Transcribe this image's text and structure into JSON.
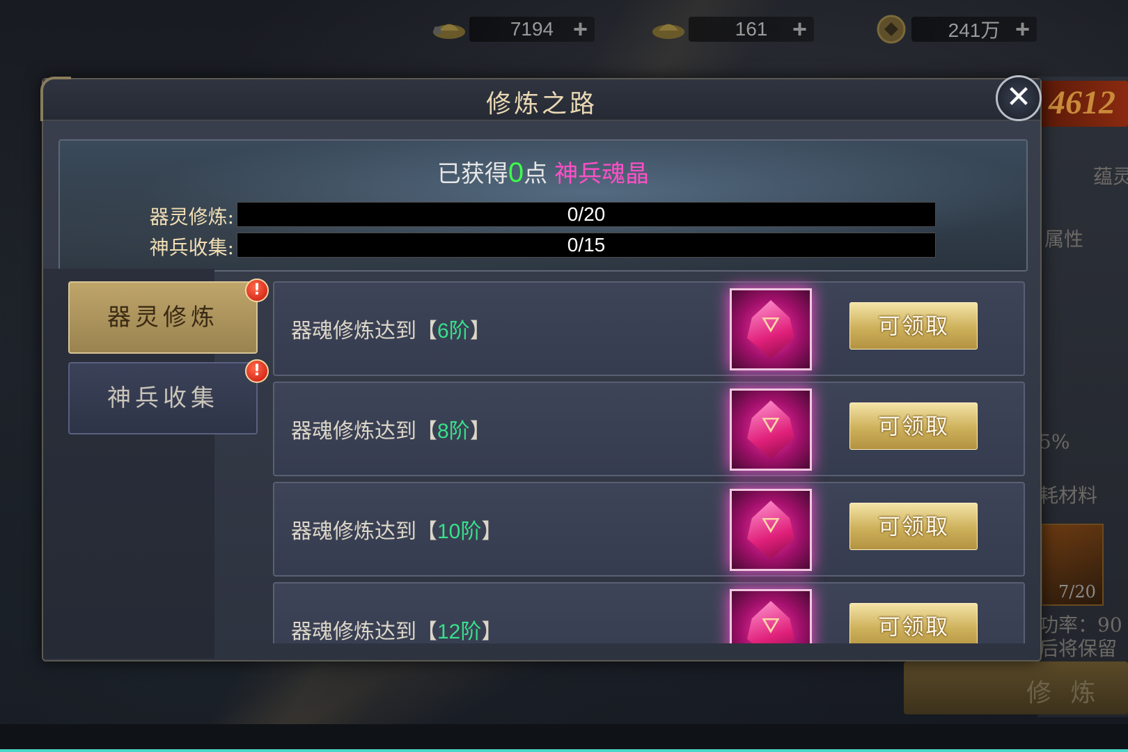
{
  "topbar": {
    "currencies": [
      {
        "icon": "gold-ingot-locked-icon",
        "value": "7194",
        "plus": "+"
      },
      {
        "icon": "gold-ingot-icon",
        "value": "161",
        "plus": "+"
      },
      {
        "icon": "coin-icon",
        "value": "241万",
        "plus": "+"
      }
    ]
  },
  "background": {
    "power_number": "4612",
    "right_labels": [
      "蕴灵",
      "属性",
      "5%",
      "耗材料",
      "7/20",
      "功率：90",
      "后将保留"
    ],
    "train_button": "修 炼"
  },
  "dialog": {
    "title": "修炼之路",
    "close_glyph": "✕",
    "header": {
      "prefix": "已获得",
      "points": "0",
      "suffix": "点",
      "currency_name": "神兵魂晶",
      "bars": [
        {
          "label": "器灵修炼:",
          "text": "0/20",
          "progress": 0
        },
        {
          "label": "神兵收集:",
          "text": "0/15",
          "progress": 0
        }
      ]
    },
    "tabs": [
      {
        "label": "器灵修炼",
        "active": true,
        "badge": "!"
      },
      {
        "label": "神兵收集",
        "active": false,
        "badge": "!"
      }
    ],
    "rows": [
      {
        "prefix": "器魂修炼达到【",
        "level": "6阶",
        "suffix": "】",
        "reward_icon": "soul-crystal-icon",
        "button": "可领取"
      },
      {
        "prefix": "器魂修炼达到【",
        "level": "8阶",
        "suffix": "】",
        "reward_icon": "soul-crystal-icon",
        "button": "可领取"
      },
      {
        "prefix": "器魂修炼达到【",
        "level": "10阶",
        "suffix": "】",
        "reward_icon": "soul-crystal-icon",
        "button": "可领取"
      },
      {
        "prefix": "器魂修炼达到【",
        "level": "12阶",
        "suffix": "】",
        "reward_icon": "soul-crystal-icon",
        "button": "可领取"
      }
    ]
  },
  "colors": {
    "points_green": "#3cff4a",
    "crystal_pink": "#ff4fc7",
    "level_green": "#36e08a",
    "gold_button": "#cdb05a",
    "badge_red": "#c8140a"
  }
}
